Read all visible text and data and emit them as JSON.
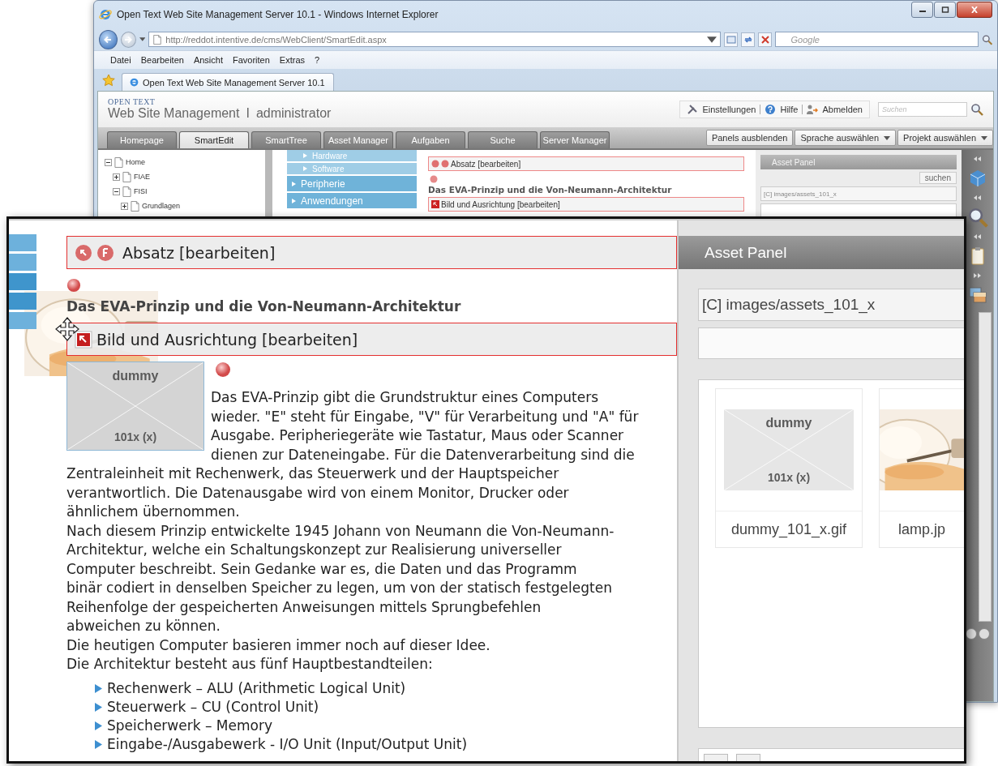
{
  "browser": {
    "title": "Open Text Web Site Management Server 10.1 - Windows Internet Explorer",
    "address": "http://reddot.intentive.de/cms/WebClient/SmartEdit.aspx",
    "search_placeholder": "Google",
    "menu": [
      "Datei",
      "Bearbeiten",
      "Ansicht",
      "Favoriten",
      "Extras",
      "?"
    ],
    "tab": "Open Text Web Site Management Server 10.1"
  },
  "app": {
    "brand": "OPEN TEXT",
    "title": "Web Site Management",
    "separator": "I",
    "user": "administrator",
    "links": [
      "Einstellungen",
      "Hilfe",
      "Abmelden"
    ],
    "search_placeholder": "Suchen",
    "tabs": [
      {
        "label": "Homepage",
        "selected": false
      },
      {
        "label": "SmartEdit",
        "selected": true
      },
      {
        "label": "SmartTree",
        "selected": false
      },
      {
        "label": "Asset Manager",
        "selected": false
      },
      {
        "label": "Aufgaben",
        "selected": false
      },
      {
        "label": "Suche",
        "selected": false
      },
      {
        "label": "Server Manager",
        "selected": false
      }
    ],
    "tools": [
      {
        "label": "Panels ausblenden",
        "dropdown": false
      },
      {
        "label": "Sprache auswählen",
        "dropdown": true
      },
      {
        "label": "Projekt auswählen",
        "dropdown": true
      }
    ],
    "tree": [
      {
        "label": "Home",
        "expanded": true,
        "children": [
          {
            "label": "FIAE",
            "expanded": false
          },
          {
            "label": "FISI",
            "expanded": true,
            "children": [
              {
                "label": "Grundlagen",
                "expanded": false
              }
            ]
          }
        ]
      }
    ],
    "nav": [
      {
        "label": "Hardware",
        "kind": "sub"
      },
      {
        "label": "Software",
        "kind": "sub"
      },
      {
        "label": "Peripherie",
        "kind": "main"
      },
      {
        "label": "Anwendungen",
        "kind": "main"
      }
    ],
    "content": {
      "paragraph_edit": "Absatz [bearbeiten]",
      "heading": "Das EVA-Prinzip und die Von-Neumann-Architektur",
      "image_edit": "Bild und Ausrichtung [bearbeiten]"
    },
    "asset_panel": {
      "title": "Asset Panel",
      "search_button": "suchen",
      "folder": "[C] images/assets_101_x"
    }
  },
  "zoom": {
    "paragraph_edit": "Absatz [bearbeiten]",
    "heading": "Das EVA-Prinzip und die Von-Neumann-Architektur",
    "image_edit": "Bild und Ausrichtung [bearbeiten]",
    "image_text": [
      "dummy",
      "101x (x)"
    ],
    "text_beside_image": " Das EVA-Prinzip gibt die Grundstruktur eines Computers\nwieder. \"E\" steht für Eingabe, \"V\" für Verarbeitung und \"A\" für\nAusgabe. Peripheriegeräte wie Tastatur, Maus oder Scanner\ndienen zur Dateneingabe. Für die Datenverarbeitung sind die",
    "paragraphs": [
      "Zentraleinheit mit Rechenwerk, das Steuerwerk und der Hauptspeicher\nverantwortlich. Die Datenausgabe wird von einem Monitor, Drucker oder\nähnlichem übernommen.",
      "Nach diesem Prinzip entwickelte 1945 Johann von Neumann die Von-Neumann-\nArchitektur, welche ein Schaltungskonzept zur Realisierung universeller\nComputer beschreibt. Sein Gedanke war es, die Daten und das Programm\nbinär codiert in denselben Speicher zu legen, um von der statisch festgelegten\nReihenfolge der gespeicherten Anweisungen mittels Sprungbefehlen\nabweichen zu können.",
      "Die heutigen Computer basieren immer noch auf dieser Idee.",
      "Die Architektur besteht aus fünf Hauptbestandteilen:"
    ],
    "list": [
      "Rechenwerk – ALU (Arithmetic Logical Unit)",
      "Steuerwerk – CU (Control Unit)",
      "Speicherwerk – Memory",
      "Eingabe-/Ausgabewerk - I/O Unit (Input/Output Unit)"
    ],
    "asset_panel": {
      "title": "Asset Panel",
      "folder": "[C] images/assets_101_x",
      "files": [
        {
          "name": "dummy_101_x.gif",
          "kind": "placeholder",
          "image_text": [
            "dummy",
            "101x (x)"
          ]
        },
        {
          "name": "lamp.jp",
          "kind": "picture"
        }
      ]
    }
  }
}
